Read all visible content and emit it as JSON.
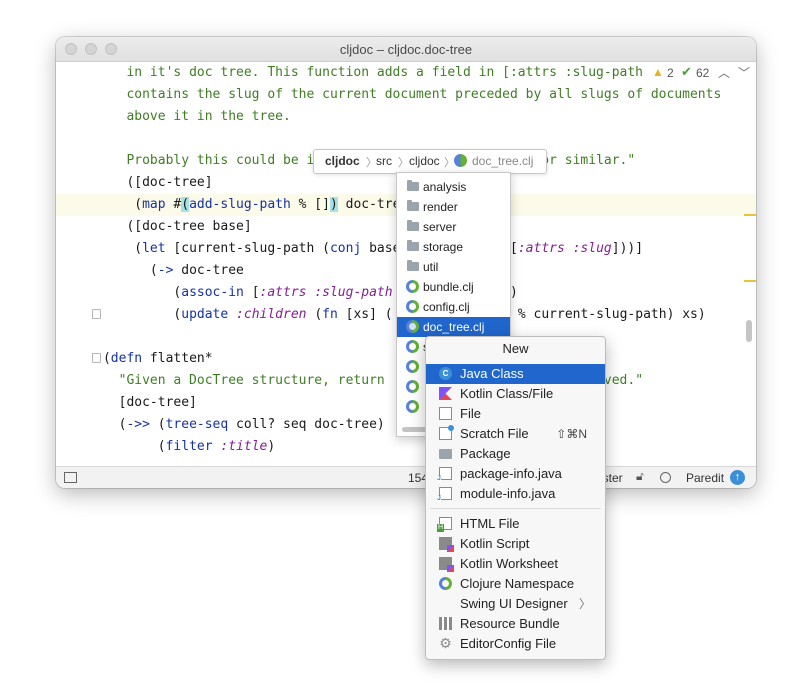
{
  "window": {
    "title": "cljdoc – cljdoc.doc-tree"
  },
  "editor": {
    "warnings_count": "2",
    "checks_count": "62",
    "lines": [
      [
        {
          "t": "in it's doc tree. This function adds a field in [:attrs :slug-path",
          "c": "str"
        }
      ],
      [
        {
          "t": "contains the slug of the current document preceded by all slugs of documents",
          "c": "str"
        }
      ],
      [
        {
          "t": "above it in the tree.",
          "c": "str"
        }
      ],
      [],
      [
        {
          "t": "Probably this could be in",
          "c": "str"
        },
        {
          "t": "                         ",
          "c": ""
        },
        {
          "t": "rs or similar.\"",
          "c": "str"
        }
      ],
      [
        {
          "t": "([doc-tree]",
          "c": ""
        }
      ],
      [
        {
          "t": " (",
          "c": ""
        },
        {
          "t": "map",
          "c": "kw"
        },
        {
          "t": " #",
          "c": ""
        },
        {
          "t": "(",
          "c": "brace"
        },
        {
          "t": "add-slug-path",
          "c": "fn"
        },
        {
          "t": " % []",
          "c": ""
        },
        {
          "t": ")",
          "c": "brace"
        },
        {
          "t": " doc-tre",
          "c": ""
        }
      ],
      [
        {
          "t": "([doc-tree base]",
          "c": ""
        }
      ],
      [
        {
          "t": " (",
          "c": ""
        },
        {
          "t": "let",
          "c": "kw"
        },
        {
          "t": " [current-slug-path (",
          "c": ""
        },
        {
          "t": "conj",
          "c": "kw"
        },
        {
          "t": " base",
          "c": ""
        },
        {
          "t": "          ",
          "c": ""
        },
        {
          "t": "ree [",
          "c": ""
        },
        {
          "t": ":attrs :slug",
          "c": "kwd"
        },
        {
          "t": "]))]",
          "c": ""
        }
      ],
      [
        {
          "t": "   (",
          "c": ""
        },
        {
          "t": "->",
          "c": "kw"
        },
        {
          "t": " doc-tree",
          "c": ""
        }
      ],
      [
        {
          "t": "      (",
          "c": ""
        },
        {
          "t": "assoc-in",
          "c": "kw"
        },
        {
          "t": " [",
          "c": ""
        },
        {
          "t": ":attrs :slug-path",
          "c": "kwd"
        },
        {
          "t": "          ",
          "c": ""
        },
        {
          "t": "-path)",
          "c": ""
        }
      ],
      [
        {
          "t": "      (",
          "c": ""
        },
        {
          "t": "update",
          "c": "kw"
        },
        {
          "t": " ",
          "c": ""
        },
        {
          "t": ":children",
          "c": "kwd"
        },
        {
          "t": " (",
          "c": ""
        },
        {
          "t": "fn",
          "c": "kw"
        },
        {
          "t": " [xs] (",
          "c": ""
        },
        {
          "t": "          ",
          "c": ""
        },
        {
          "t": "-path",
          "c": "fn"
        },
        {
          "t": " % current-slug-path) xs)",
          "c": ""
        }
      ],
      [],
      [
        {
          "t": "(",
          "c": ""
        },
        {
          "t": "defn",
          "c": "kw"
        },
        {
          "t": " flatten*",
          "c": ""
        }
      ],
      [
        {
          "t": "  \"Given a DocTree structure, return",
          "c": "str"
        },
        {
          "t": "                      ",
          "c": ""
        },
        {
          "t": "n removed.\"",
          "c": "str"
        }
      ],
      [
        {
          "t": "  [doc-tree]",
          "c": ""
        }
      ],
      [
        {
          "t": "  (",
          "c": ""
        },
        {
          "t": "->>",
          "c": "kw"
        },
        {
          "t": " (",
          "c": ""
        },
        {
          "t": "tree-seq",
          "c": "kw"
        },
        {
          "t": " coll? seq doc-tree)",
          "c": ""
        }
      ],
      [
        {
          "t": "       (",
          "c": ""
        },
        {
          "t": "filter",
          "c": "kw"
        },
        {
          "t": " ",
          "c": ""
        },
        {
          "t": ":title",
          "c": "kwd"
        },
        {
          "t": ")",
          "c": ""
        }
      ]
    ]
  },
  "statusbar": {
    "position": "154",
    "branch": "aster",
    "mode": "Paredit"
  },
  "navbar": {
    "crumbs": [
      "cljdoc",
      "src",
      "cljdoc",
      "doc_tree.clj"
    ]
  },
  "folder_popup": {
    "items": [
      {
        "label": "analysis",
        "kind": "folder"
      },
      {
        "label": "render",
        "kind": "folder"
      },
      {
        "label": "server",
        "kind": "folder"
      },
      {
        "label": "storage",
        "kind": "folder"
      },
      {
        "label": "util",
        "kind": "folder"
      },
      {
        "label": "bundle.clj",
        "kind": "clj"
      },
      {
        "label": "config.clj",
        "kind": "clj"
      },
      {
        "label": "doc_tree.clj",
        "kind": "clj",
        "selected": true
      },
      {
        "label": "s",
        "kind": "clj"
      },
      {
        "label": "",
        "kind": "clj"
      },
      {
        "label": "",
        "kind": "clj"
      },
      {
        "label": "",
        "kind": "clj"
      }
    ]
  },
  "new_menu": {
    "title": "New",
    "groups": [
      [
        {
          "label": "Java Class",
          "icon": "java-class-icon",
          "selected": true
        },
        {
          "label": "Kotlin Class/File",
          "icon": "kotlin-class-icon"
        },
        {
          "label": "File",
          "icon": "file-icon"
        },
        {
          "label": "Scratch File",
          "icon": "scratch-file-icon",
          "shortcut": "⇧⌘N"
        },
        {
          "label": "Package",
          "icon": "package-icon"
        },
        {
          "label": "package-info.java",
          "icon": "java-file-icon"
        },
        {
          "label": "module-info.java",
          "icon": "java-file-icon"
        }
      ],
      [
        {
          "label": "HTML File",
          "icon": "html-file-icon"
        },
        {
          "label": "Kotlin Script",
          "icon": "kotlin-script-icon"
        },
        {
          "label": "Kotlin Worksheet",
          "icon": "kotlin-worksheet-icon"
        },
        {
          "label": "Clojure Namespace",
          "icon": "clojure-icon"
        },
        {
          "label": "Swing UI Designer",
          "icon": "",
          "submenu": true
        },
        {
          "label": "Resource Bundle",
          "icon": "resource-bundle-icon"
        },
        {
          "label": "EditorConfig File",
          "icon": "gear-icon"
        }
      ]
    ]
  }
}
